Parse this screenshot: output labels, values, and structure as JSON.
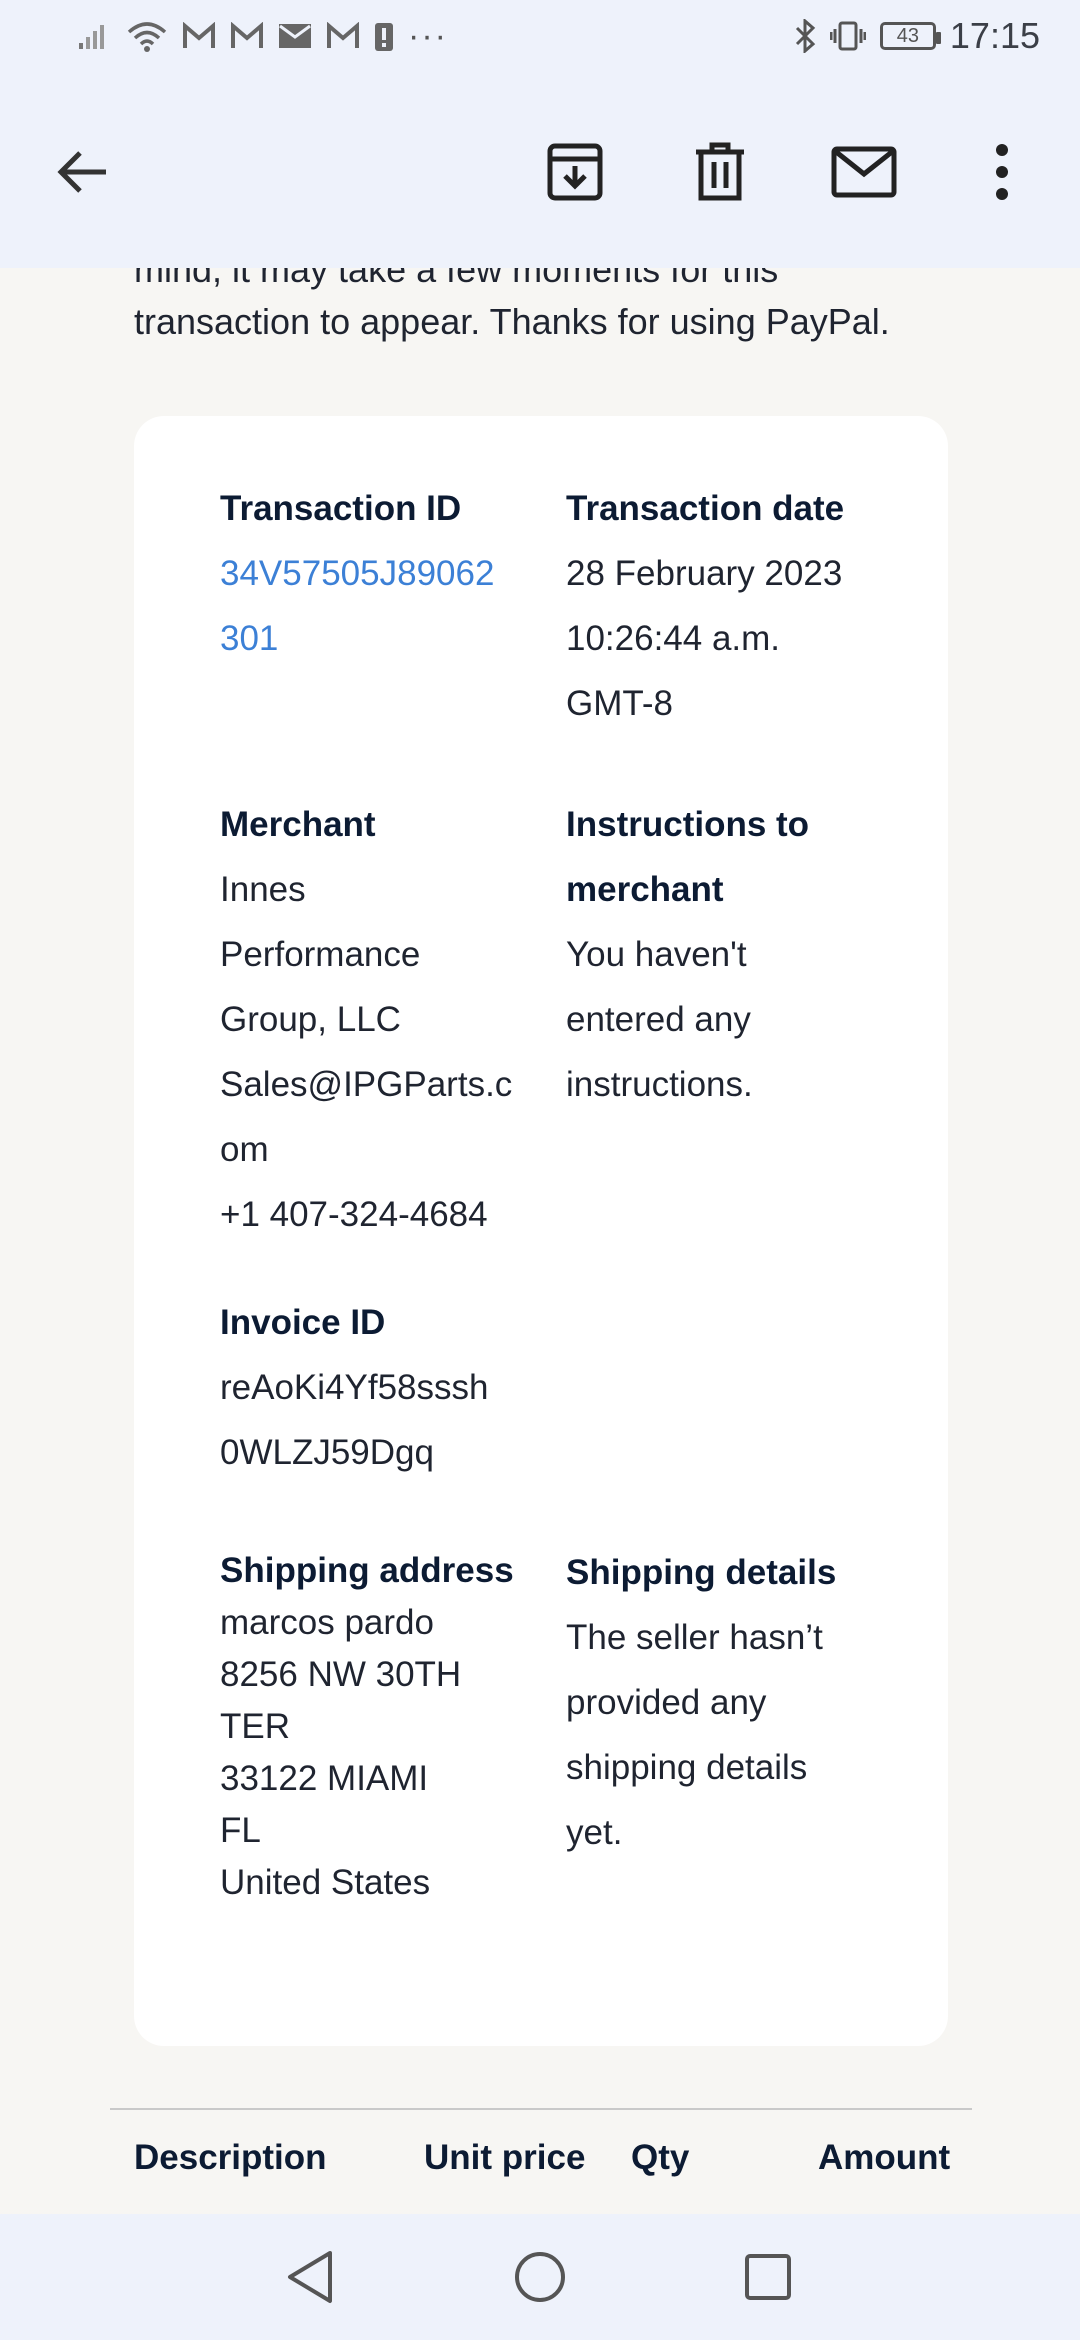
{
  "status_bar": {
    "time": "17:15",
    "battery": "43",
    "overflow": "···",
    "icons": [
      "signal-icon",
      "wifi-icon",
      "gmail-icon",
      "gmail-icon",
      "mail-icon",
      "gmail-icon",
      "alert-icon",
      "bluetooth-icon",
      "vibrate-icon"
    ]
  },
  "toolbar": {
    "icons": [
      "back-arrow-icon",
      "archive-icon",
      "delete-icon",
      "mark-unread-icon",
      "more-vert-icon"
    ]
  },
  "email": {
    "intro_line1": "mind, it may take a few moments for this",
    "intro_line2": "transaction to appear. Thanks for using PayPal.",
    "transaction_id": {
      "label": "Transaction ID",
      "line1": "34V57505J89062",
      "line2": "301"
    },
    "transaction_date": {
      "label": "Transaction date",
      "line1": "28 February 2023",
      "line2": "10:26:44 a.m.",
      "line3": "GMT-8"
    },
    "merchant": {
      "label": "Merchant",
      "line1": "Innes",
      "line2": "Performance",
      "line3": "Group, LLC",
      "line4": "Sales@IPGParts.c",
      "line5": "om",
      "line6": "+1 407-324-4684"
    },
    "instructions": {
      "label_line1": "Instructions to",
      "label_line2": "merchant",
      "line1": "You haven't",
      "line2": "entered any",
      "line3": "instructions."
    },
    "invoice": {
      "label": "Invoice ID",
      "line1": "reAoKi4Yf58sssh",
      "line2": "0WLZJ59Dgq"
    },
    "shipping_address": {
      "label": "Shipping address",
      "line1": "marcos pardo",
      "line2": "8256 NW 30TH",
      "line3": "TER",
      "line4": "33122 MIAMI",
      "line5": "FL",
      "line6": "United States"
    },
    "shipping_details": {
      "label": "Shipping details",
      "line1": "The seller hasn’t",
      "line2": "provided any",
      "line3": "shipping details",
      "line4": "yet."
    },
    "table_headers": {
      "description": "Description",
      "unit_price": "Unit price",
      "qty": "Qty",
      "amount": "Amount"
    }
  },
  "nav_bar": {
    "icons": [
      "nav-back-icon",
      "nav-home-icon",
      "nav-recents-icon"
    ]
  },
  "colors": {
    "link": "#3c80d6",
    "label": "#0c1b33",
    "app_bar": "#eef2fb",
    "background": "#f7f6f3",
    "card": "#ffffff"
  }
}
